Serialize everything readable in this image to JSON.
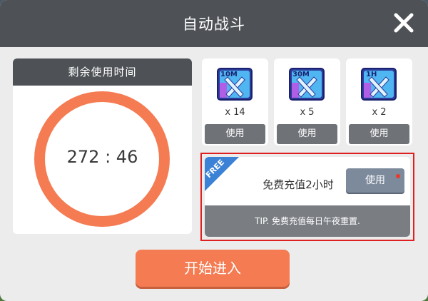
{
  "dialog": {
    "title": "自动战斗",
    "close_icon": "close-icon"
  },
  "timer": {
    "header": "剩余使用时间",
    "value": "272 : 46",
    "ring_color": "#f47b52"
  },
  "items": [
    {
      "icon_label": "10M",
      "count": "x 14",
      "use_label": "使用",
      "icon": "sword-ticket-icon"
    },
    {
      "icon_label": "30M",
      "count": "x 5",
      "use_label": "使用",
      "icon": "sword-ticket-icon"
    },
    {
      "icon_label": "1H",
      "count": "x 2",
      "use_label": "使用",
      "icon": "sword-ticket-icon"
    }
  ],
  "free": {
    "ribbon": "FREE",
    "label": "免费充值2小时",
    "use_label": "使用",
    "tip": "TIP. 免费充值每日午夜重置."
  },
  "start_label": "开始进入",
  "colors": {
    "accent": "#f47b52",
    "header_bg": "#4e5256",
    "highlight_border": "#e02020",
    "ribbon": "#3b82d6"
  }
}
